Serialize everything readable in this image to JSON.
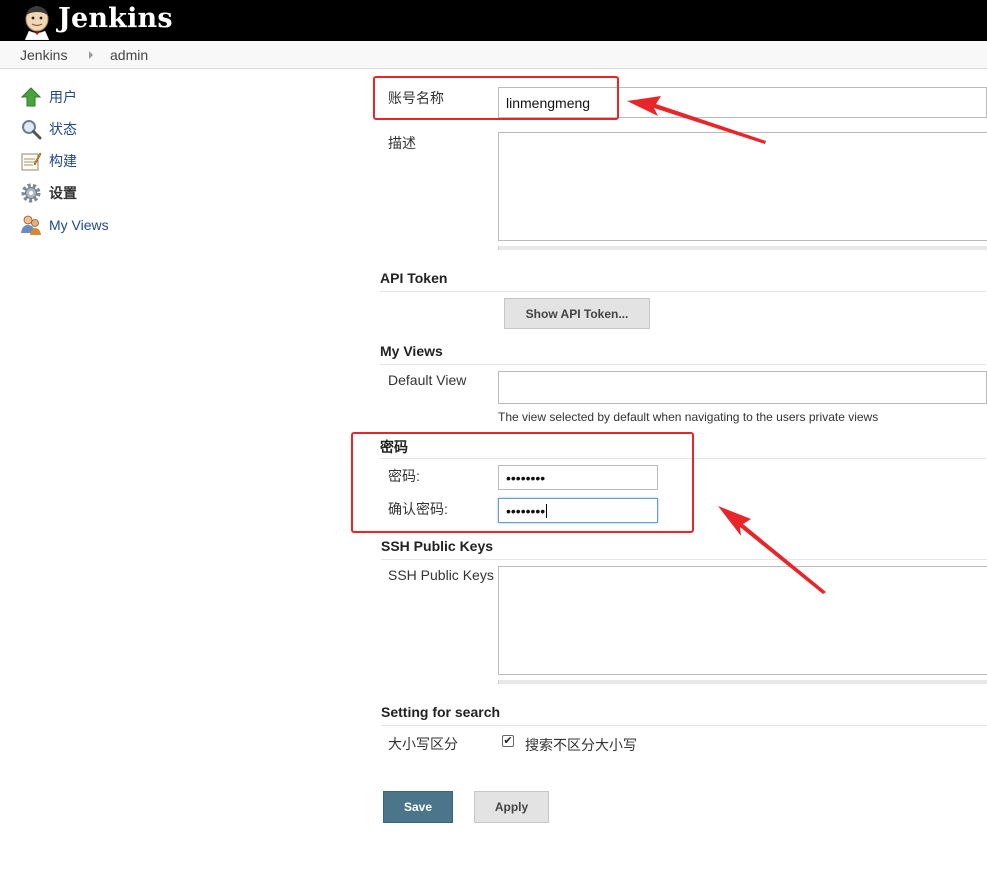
{
  "header": {
    "app_name": "Jenkins"
  },
  "breadcrumbs": [
    "Jenkins",
    "admin"
  ],
  "sidebar": {
    "items": [
      {
        "label": "用户",
        "icon": "up-arrow-icon"
      },
      {
        "label": "状态",
        "icon": "magnifier-icon"
      },
      {
        "label": "构建",
        "icon": "notepad-icon"
      },
      {
        "label": "设置",
        "icon": "gear-icon",
        "active": true
      },
      {
        "label": "My Views",
        "icon": "users-icon"
      }
    ]
  },
  "form": {
    "full_name": {
      "label": "账号名称",
      "value": "linmengmeng"
    },
    "description": {
      "label": "描述",
      "value": ""
    },
    "api_token": {
      "section": "API Token",
      "button": "Show API Token..."
    },
    "my_views": {
      "section": "My Views",
      "default_view_label": "Default View",
      "default_view_value": "",
      "help": "The view selected by default when navigating to the users private views"
    },
    "password": {
      "section": "密码",
      "password_label": "密码:",
      "password_value": "••••••••",
      "confirm_label": "确认密码:",
      "confirm_value": "••••••••"
    },
    "ssh": {
      "section": "SSH Public Keys",
      "label": "SSH Public Keys",
      "value": ""
    },
    "search": {
      "section": "Setting for search",
      "label": "大小写区分",
      "checkbox_checked": true,
      "checkbox_label": "搜索不区分大小写"
    },
    "buttons": {
      "save": "Save",
      "apply": "Apply"
    }
  },
  "colors": {
    "accent": "#4b758b",
    "annotation": "#e8262a",
    "link": "#204a87"
  }
}
